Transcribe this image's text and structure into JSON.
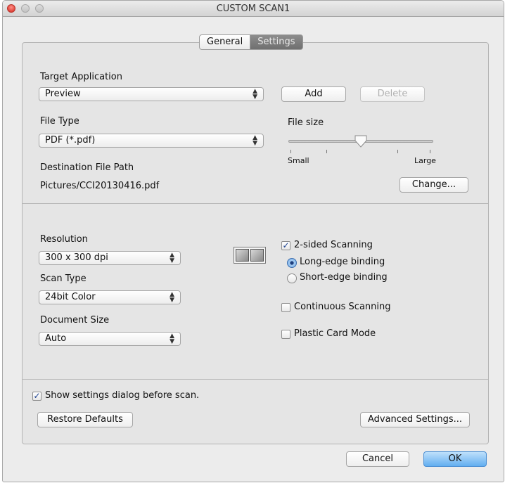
{
  "window": {
    "title": "CUSTOM SCAN1"
  },
  "tabs": [
    {
      "label": "General",
      "selected": false
    },
    {
      "label": "Settings",
      "selected": true
    }
  ],
  "target_application": {
    "label": "Target Application",
    "selected": "Preview",
    "add_button": "Add",
    "delete_button": "Delete"
  },
  "file_type": {
    "label": "File Type",
    "selected": "PDF (*.pdf)"
  },
  "file_size": {
    "label": "File size",
    "min_label": "Small",
    "max_label": "Large",
    "value_fraction": 0.5
  },
  "destination": {
    "label": "Destination File Path",
    "path": "Pictures/CCI20130416.pdf",
    "change_button": "Change..."
  },
  "resolution": {
    "label": "Resolution",
    "selected": "300 x 300 dpi"
  },
  "scan_type": {
    "label": "Scan Type",
    "selected": "24bit Color"
  },
  "document_size": {
    "label": "Document Size",
    "selected": "Auto"
  },
  "two_sided": {
    "label": "2-sided Scanning",
    "checked": true,
    "icon": "duplex-scan-icon",
    "options": [
      {
        "label": "Long-edge binding",
        "selected": true
      },
      {
        "label": "Short-edge binding",
        "selected": false
      }
    ]
  },
  "continuous": {
    "label": "Continuous Scanning",
    "checked": false
  },
  "plastic_card": {
    "label": "Plastic Card Mode",
    "checked": false
  },
  "show_dialog": {
    "label": "Show settings dialog before scan.",
    "checked": true
  },
  "buttons": {
    "restore_defaults": "Restore Defaults",
    "advanced_settings": "Advanced Settings...",
    "cancel": "Cancel",
    "ok": "OK"
  },
  "icons": {
    "popup_arrows": "⇕",
    "checkmark": "✓"
  },
  "colors": {
    "default_button": "#62aef0",
    "selected_tab": "#7e7e7e",
    "close_light": "#e0443a"
  }
}
